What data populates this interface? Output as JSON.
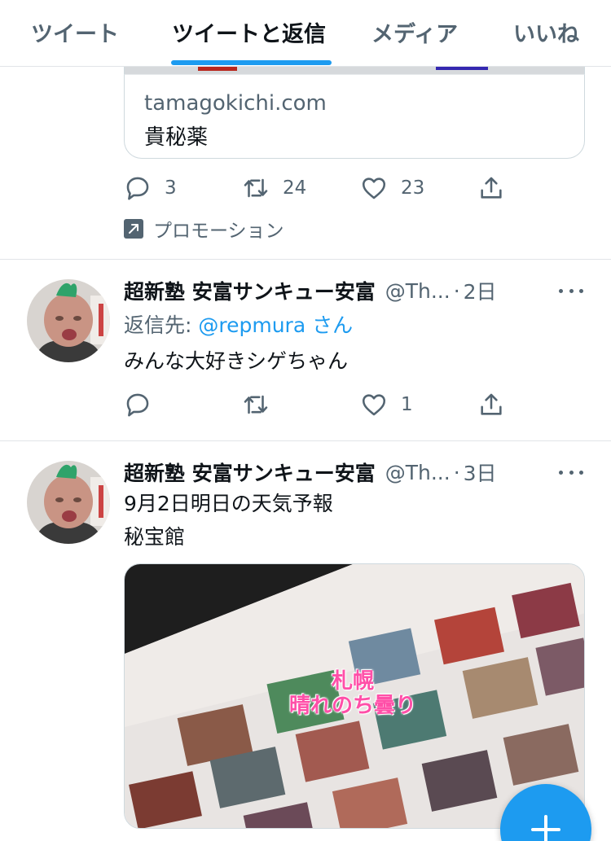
{
  "tabs": [
    {
      "label": "ツイート"
    },
    {
      "label": "ツイートと返信"
    },
    {
      "label": "メディア"
    },
    {
      "label": "いいね"
    }
  ],
  "promo_tweet": {
    "card": {
      "domain": "tamagokichi.com",
      "title": "貴秘薬"
    },
    "reply_count": "3",
    "retweet_count": "24",
    "like_count": "23",
    "promoted_label": "プロモーション"
  },
  "tweets": [
    {
      "author": "超新塾 安富サンキュー安富",
      "handle": "@Th...",
      "separator": "·",
      "time": "2日",
      "reply_prefix": "返信先: ",
      "reply_mention": "@repmura",
      "reply_suffix": " さん",
      "text": "みんな大好きシゲちゃん",
      "reply_count": "",
      "retweet_count": "",
      "like_count": "1"
    },
    {
      "author": "超新塾 安富サンキュー安富",
      "handle": "@Th...",
      "separator": "·",
      "time": "3日",
      "text_line1": "9月2日明日の天気予報",
      "text_line2": "秘宝館",
      "media_caption_line1": "札幌",
      "media_caption_line2": "晴れのち曇り"
    }
  ],
  "colors": {
    "accent": "#1d9bf0",
    "secondary_text": "#536471",
    "caption_pink": "#ff4fa8"
  },
  "icons": {
    "reply": "reply-icon",
    "retweet": "retweet-icon",
    "like": "heart-icon",
    "share": "share-icon",
    "compose": "plus-icon"
  }
}
